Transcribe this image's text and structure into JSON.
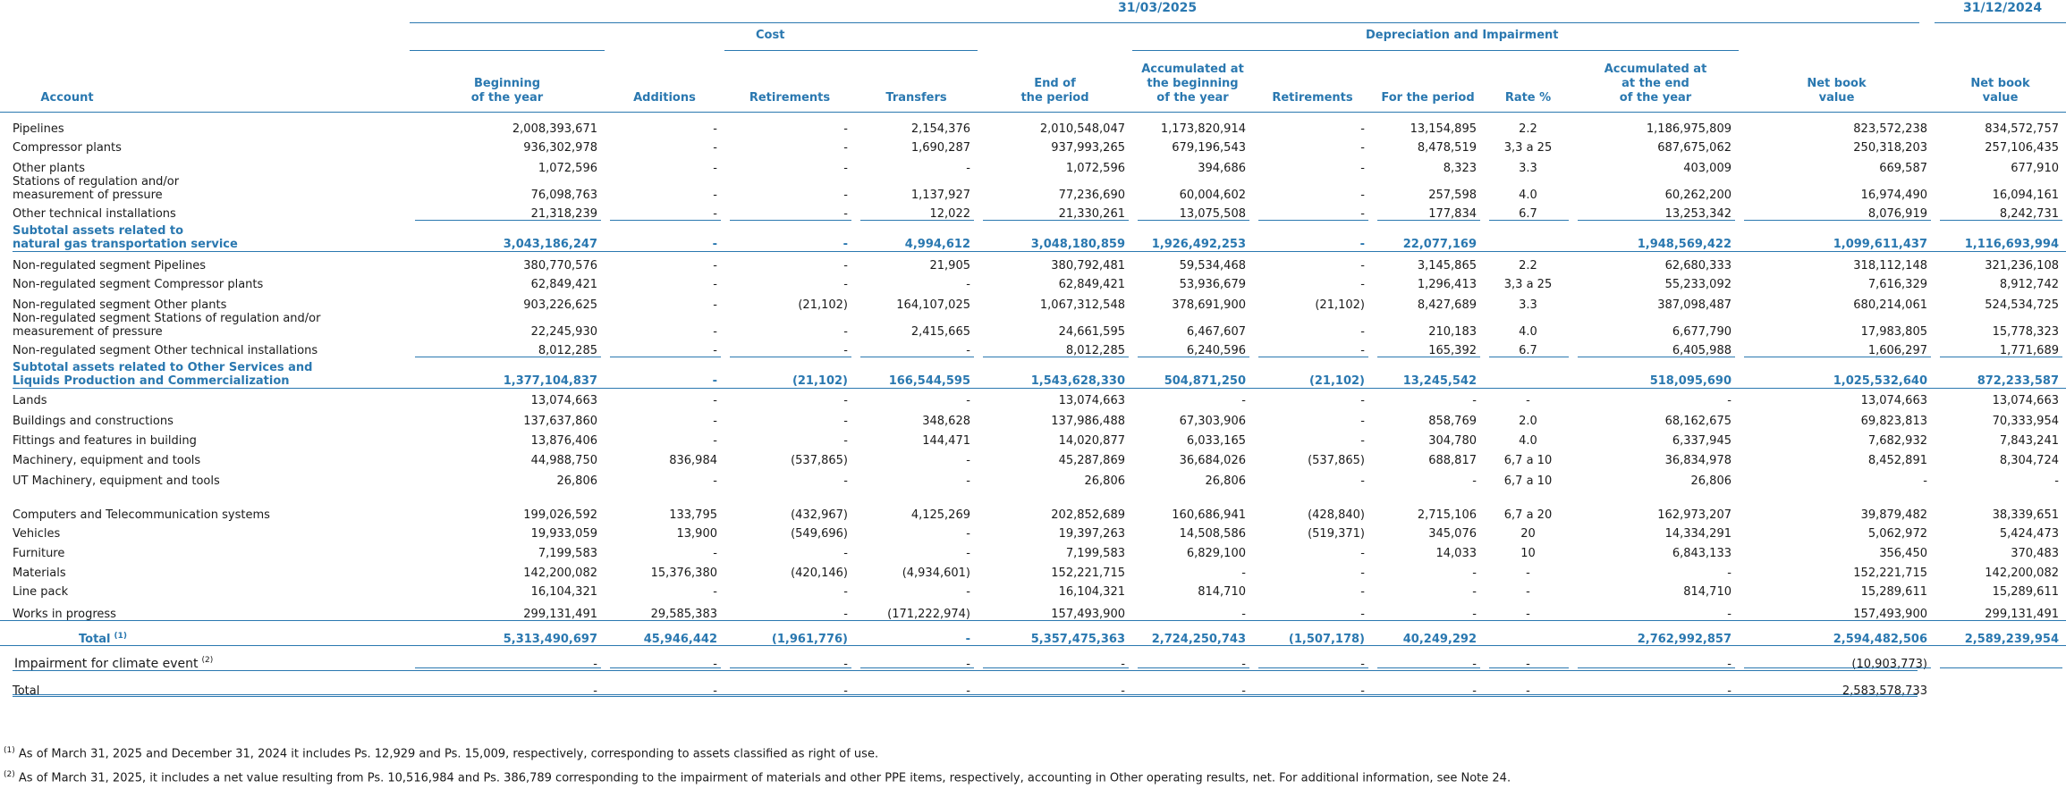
{
  "header": {
    "period_current": "31/03/2025",
    "period_prior": "31/12/2024",
    "group_cost": "Cost",
    "group_depreciation": "Depreciation and Impairment"
  },
  "columns": [
    "Account",
    "Beginning\nof the year",
    "Additions",
    "Retirements",
    "Transfers",
    "End of\nthe period",
    "Accumulated at\nthe beginning\nof the year",
    "Retirements",
    "For the period",
    "Rate %",
    "Accumulated at\nat the end\nof the year",
    "Net book\nvalue",
    "Net book\nvalue"
  ],
  "rows": [
    {
      "label": "Pipelines",
      "cells": [
        "2,008,393,671",
        "-",
        "-",
        "2,154,376",
        "2,010,548,047",
        "1,173,820,914",
        "-",
        "13,154,895",
        "2.2",
        "1,186,975,809",
        "823,572,238",
        "834,572,757"
      ]
    },
    {
      "label": "Compressor plants",
      "cells": [
        "936,302,978",
        "-",
        "-",
        "1,690,287",
        "937,993,265",
        "679,196,543",
        "-",
        "8,478,519",
        "3,3 a 25",
        "687,675,062",
        "250,318,203",
        "257,106,435"
      ]
    },
    {
      "label": "Other plants",
      "cells": [
        "1,072,596",
        "-",
        "-",
        "-",
        "1,072,596",
        "394,686",
        "-",
        "8,323",
        "3.3",
        "403,009",
        "669,587",
        "677,910"
      ]
    },
    {
      "label": "Stations of regulation and/or\nmeasurement of pressure",
      "cells": [
        "76,098,763",
        "-",
        "-",
        "1,137,927",
        "77,236,690",
        "60,004,602",
        "-",
        "257,598",
        "4.0",
        "60,262,200",
        "16,974,490",
        "16,094,161"
      ]
    },
    {
      "label": "Other technical installations",
      "cells": [
        "21,318,239",
        "-",
        "-",
        "12,022",
        "21,330,261",
        "13,075,508",
        "-",
        "177,834",
        "6.7",
        "13,253,342",
        "8,076,919",
        "8,242,731"
      ]
    },
    {
      "label": "Subtotal assets related to\nnatural gas transportation service",
      "type": "sub",
      "cells": [
        "3,043,186,247",
        "-",
        "-",
        "4,994,612",
        "3,048,180,859",
        "1,926,492,253",
        "-",
        "22,077,169",
        "",
        "1,948,569,422",
        "1,099,611,437",
        "1,116,693,994"
      ]
    },
    {
      "label": "Non-regulated segment Pipelines",
      "cells": [
        "380,770,576",
        "-",
        "-",
        "21,905",
        "380,792,481",
        "59,534,468",
        "-",
        "3,145,865",
        "2.2",
        "62,680,333",
        "318,112,148",
        "321,236,108"
      ]
    },
    {
      "label": "Non-regulated segment Compressor plants",
      "cells": [
        "62,849,421",
        "-",
        "-",
        "-",
        "62,849,421",
        "53,936,679",
        "-",
        "1,296,413",
        "3,3 a 25",
        "55,233,092",
        "7,616,329",
        "8,912,742"
      ]
    },
    {
      "label": "Non-regulated segment Other plants",
      "cells": [
        "903,226,625",
        "-",
        "(21,102)",
        "164,107,025",
        "1,067,312,548",
        "378,691,900",
        "(21,102)",
        "8,427,689",
        "3.3",
        "387,098,487",
        "680,214,061",
        "524,534,725"
      ]
    },
    {
      "label": "Non-regulated segment Stations of regulation and/or\nmeasurement of pressure",
      "cells": [
        "22,245,930",
        "-",
        "-",
        "2,415,665",
        "24,661,595",
        "6,467,607",
        "-",
        "210,183",
        "4.0",
        "6,677,790",
        "17,983,805",
        "15,778,323"
      ]
    },
    {
      "label": "Non-regulated segment Other technical installations",
      "cells": [
        "8,012,285",
        "-",
        "-",
        "-",
        "8,012,285",
        "6,240,596",
        "-",
        "165,392",
        "6.7",
        "6,405,988",
        "1,606,297",
        "1,771,689"
      ]
    },
    {
      "label": "Subtotal assets related to Other Services and\nLiquids Production and Commercialization",
      "type": "sub",
      "cells": [
        "1,377,104,837",
        "-",
        "(21,102)",
        "166,544,595",
        "1,543,628,330",
        "504,871,250",
        "(21,102)",
        "13,245,542",
        "",
        "518,095,690",
        "1,025,532,640",
        "872,233,587"
      ]
    },
    {
      "label": "Lands",
      "cells": [
        "13,074,663",
        "-",
        "-",
        "-",
        "13,074,663",
        "-",
        "-",
        "-",
        "-",
        "-",
        "13,074,663",
        "13,074,663"
      ]
    },
    {
      "label": "Buildings and constructions",
      "cells": [
        "137,637,860",
        "-",
        "-",
        "348,628",
        "137,986,488",
        "67,303,906",
        "-",
        "858,769",
        "2.0",
        "68,162,675",
        "69,823,813",
        "70,333,954"
      ]
    },
    {
      "label": "Fittings and features in building",
      "cells": [
        "13,876,406",
        "-",
        "-",
        "144,471",
        "14,020,877",
        "6,033,165",
        "-",
        "304,780",
        "4.0",
        "6,337,945",
        "7,682,932",
        "7,843,241"
      ]
    },
    {
      "label": "Machinery, equipment and tools",
      "cells": [
        "44,988,750",
        "836,984",
        "(537,865)",
        "-",
        "45,287,869",
        "36,684,026",
        "(537,865)",
        "688,817",
        "6,7 a 10",
        "36,834,978",
        "8,452,891",
        "8,304,724"
      ]
    },
    {
      "label": "UT Machinery, equipment and tools",
      "cells": [
        "26,806",
        "-",
        "-",
        "-",
        "26,806",
        "26,806",
        "-",
        "-",
        "6,7 a 10",
        "26,806",
        "-",
        "-"
      ]
    },
    {
      "label": "",
      "type": "spacer",
      "cells": [
        "",
        "",
        "",
        "",
        "",
        "",
        "",
        "",
        "",
        "",
        "",
        ""
      ]
    },
    {
      "label": "Computers and Telecommunication systems",
      "cells": [
        "199,026,592",
        "133,795",
        "(432,967)",
        "4,125,269",
        "202,852,689",
        "160,686,941",
        "(428,840)",
        "2,715,106",
        "6,7 a 20",
        "162,973,207",
        "39,879,482",
        "38,339,651"
      ]
    },
    {
      "label": "Vehicles",
      "cells": [
        "19,933,059",
        "13,900",
        "(549,696)",
        "-",
        "19,397,263",
        "14,508,586",
        "(519,371)",
        "345,076",
        "20",
        "14,334,291",
        "5,062,972",
        "5,424,473"
      ]
    },
    {
      "label": "Furniture",
      "cells": [
        "7,199,583",
        "-",
        "-",
        "-",
        "7,199,583",
        "6,829,100",
        "-",
        "14,033",
        "10",
        "6,843,133",
        "356,450",
        "370,483"
      ]
    },
    {
      "label": "Materials",
      "cells": [
        "142,200,082",
        "15,376,380",
        "(420,146)",
        "(4,934,601)",
        "152,221,715",
        "-",
        "-",
        "-",
        "-",
        "-",
        "152,221,715",
        "142,200,082"
      ]
    },
    {
      "label": "Line pack",
      "cells": [
        "16,104,321",
        "-",
        "-",
        "-",
        "16,104,321",
        "814,710",
        "-",
        "-",
        "-",
        "814,710",
        "15,289,611",
        "15,289,611"
      ]
    },
    {
      "label": "Works in progress",
      "cells": [
        "299,131,491",
        "29,585,383",
        "-",
        "(171,222,974)",
        "157,493,900",
        "-",
        "-",
        "-",
        "-",
        "-",
        "157,493,900",
        "299,131,491"
      ]
    },
    {
      "label": "Total",
      "type": "tot",
      "sup": "(1)",
      "cells": [
        "5,313,490,697",
        "45,946,442",
        "(1,961,776)",
        "-",
        "5,357,475,363",
        "2,724,250,743",
        "(1,507,178)",
        "40,249,292",
        "",
        "2,762,992,857",
        "2,594,482,506",
        "2,589,239,954"
      ]
    },
    {
      "label": "Impairment for climate event",
      "type": "imp",
      "sup": "(2)",
      "cells": [
        "-",
        "-",
        "-",
        "-",
        "-",
        "-",
        "-",
        "-",
        "-",
        "-",
        "(10,903,773)",
        ""
      ]
    },
    {
      "label": "Total",
      "type": "fin",
      "cells": [
        "-",
        "-",
        "-",
        "-",
        "-",
        "-",
        "-",
        "-",
        "-",
        "-",
        "2,583,578,733",
        ""
      ]
    }
  ],
  "footnotes": [
    {
      "mark": "(1)",
      "text": "As of March 31, 2025 and December 31, 2024 it includes Ps. 12,929 and Ps. 15,009, respectively, corresponding to assets classified as right of use."
    },
    {
      "mark": "(2)",
      "text": "As of March 31, 2025, it includes a net value resulting from Ps. 10,516,984 and Ps. 386,789 corresponding to the impairment of materials and other PPE items, respectively, accounting in Other operating results, net. For additional information, see Note 24."
    }
  ]
}
